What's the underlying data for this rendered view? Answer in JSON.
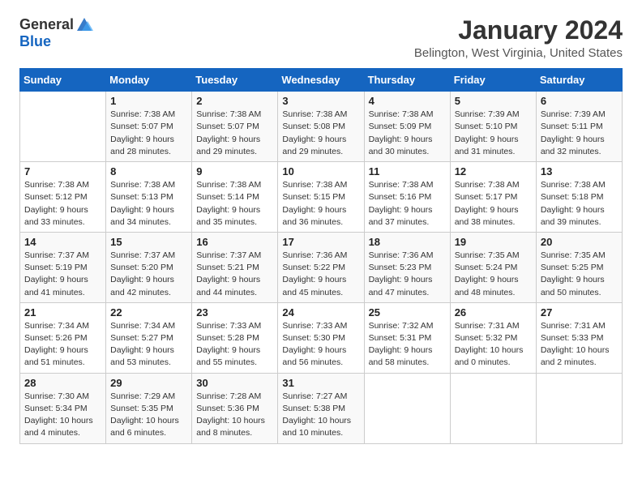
{
  "logo": {
    "general": "General",
    "blue": "Blue"
  },
  "title": "January 2024",
  "subtitle": "Belington, West Virginia, United States",
  "days_header": [
    "Sunday",
    "Monday",
    "Tuesday",
    "Wednesday",
    "Thursday",
    "Friday",
    "Saturday"
  ],
  "weeks": [
    [
      {
        "day": "",
        "info": ""
      },
      {
        "day": "1",
        "info": "Sunrise: 7:38 AM\nSunset: 5:07 PM\nDaylight: 9 hours\nand 28 minutes."
      },
      {
        "day": "2",
        "info": "Sunrise: 7:38 AM\nSunset: 5:07 PM\nDaylight: 9 hours\nand 29 minutes."
      },
      {
        "day": "3",
        "info": "Sunrise: 7:38 AM\nSunset: 5:08 PM\nDaylight: 9 hours\nand 29 minutes."
      },
      {
        "day": "4",
        "info": "Sunrise: 7:38 AM\nSunset: 5:09 PM\nDaylight: 9 hours\nand 30 minutes."
      },
      {
        "day": "5",
        "info": "Sunrise: 7:39 AM\nSunset: 5:10 PM\nDaylight: 9 hours\nand 31 minutes."
      },
      {
        "day": "6",
        "info": "Sunrise: 7:39 AM\nSunset: 5:11 PM\nDaylight: 9 hours\nand 32 minutes."
      }
    ],
    [
      {
        "day": "7",
        "info": "Sunrise: 7:38 AM\nSunset: 5:12 PM\nDaylight: 9 hours\nand 33 minutes."
      },
      {
        "day": "8",
        "info": "Sunrise: 7:38 AM\nSunset: 5:13 PM\nDaylight: 9 hours\nand 34 minutes."
      },
      {
        "day": "9",
        "info": "Sunrise: 7:38 AM\nSunset: 5:14 PM\nDaylight: 9 hours\nand 35 minutes."
      },
      {
        "day": "10",
        "info": "Sunrise: 7:38 AM\nSunset: 5:15 PM\nDaylight: 9 hours\nand 36 minutes."
      },
      {
        "day": "11",
        "info": "Sunrise: 7:38 AM\nSunset: 5:16 PM\nDaylight: 9 hours\nand 37 minutes."
      },
      {
        "day": "12",
        "info": "Sunrise: 7:38 AM\nSunset: 5:17 PM\nDaylight: 9 hours\nand 38 minutes."
      },
      {
        "day": "13",
        "info": "Sunrise: 7:38 AM\nSunset: 5:18 PM\nDaylight: 9 hours\nand 39 minutes."
      }
    ],
    [
      {
        "day": "14",
        "info": "Sunrise: 7:37 AM\nSunset: 5:19 PM\nDaylight: 9 hours\nand 41 minutes."
      },
      {
        "day": "15",
        "info": "Sunrise: 7:37 AM\nSunset: 5:20 PM\nDaylight: 9 hours\nand 42 minutes."
      },
      {
        "day": "16",
        "info": "Sunrise: 7:37 AM\nSunset: 5:21 PM\nDaylight: 9 hours\nand 44 minutes."
      },
      {
        "day": "17",
        "info": "Sunrise: 7:36 AM\nSunset: 5:22 PM\nDaylight: 9 hours\nand 45 minutes."
      },
      {
        "day": "18",
        "info": "Sunrise: 7:36 AM\nSunset: 5:23 PM\nDaylight: 9 hours\nand 47 minutes."
      },
      {
        "day": "19",
        "info": "Sunrise: 7:35 AM\nSunset: 5:24 PM\nDaylight: 9 hours\nand 48 minutes."
      },
      {
        "day": "20",
        "info": "Sunrise: 7:35 AM\nSunset: 5:25 PM\nDaylight: 9 hours\nand 50 minutes."
      }
    ],
    [
      {
        "day": "21",
        "info": "Sunrise: 7:34 AM\nSunset: 5:26 PM\nDaylight: 9 hours\nand 51 minutes."
      },
      {
        "day": "22",
        "info": "Sunrise: 7:34 AM\nSunset: 5:27 PM\nDaylight: 9 hours\nand 53 minutes."
      },
      {
        "day": "23",
        "info": "Sunrise: 7:33 AM\nSunset: 5:28 PM\nDaylight: 9 hours\nand 55 minutes."
      },
      {
        "day": "24",
        "info": "Sunrise: 7:33 AM\nSunset: 5:30 PM\nDaylight: 9 hours\nand 56 minutes."
      },
      {
        "day": "25",
        "info": "Sunrise: 7:32 AM\nSunset: 5:31 PM\nDaylight: 9 hours\nand 58 minutes."
      },
      {
        "day": "26",
        "info": "Sunrise: 7:31 AM\nSunset: 5:32 PM\nDaylight: 10 hours\nand 0 minutes."
      },
      {
        "day": "27",
        "info": "Sunrise: 7:31 AM\nSunset: 5:33 PM\nDaylight: 10 hours\nand 2 minutes."
      }
    ],
    [
      {
        "day": "28",
        "info": "Sunrise: 7:30 AM\nSunset: 5:34 PM\nDaylight: 10 hours\nand 4 minutes."
      },
      {
        "day": "29",
        "info": "Sunrise: 7:29 AM\nSunset: 5:35 PM\nDaylight: 10 hours\nand 6 minutes."
      },
      {
        "day": "30",
        "info": "Sunrise: 7:28 AM\nSunset: 5:36 PM\nDaylight: 10 hours\nand 8 minutes."
      },
      {
        "day": "31",
        "info": "Sunrise: 7:27 AM\nSunset: 5:38 PM\nDaylight: 10 hours\nand 10 minutes."
      },
      {
        "day": "",
        "info": ""
      },
      {
        "day": "",
        "info": ""
      },
      {
        "day": "",
        "info": ""
      }
    ]
  ]
}
